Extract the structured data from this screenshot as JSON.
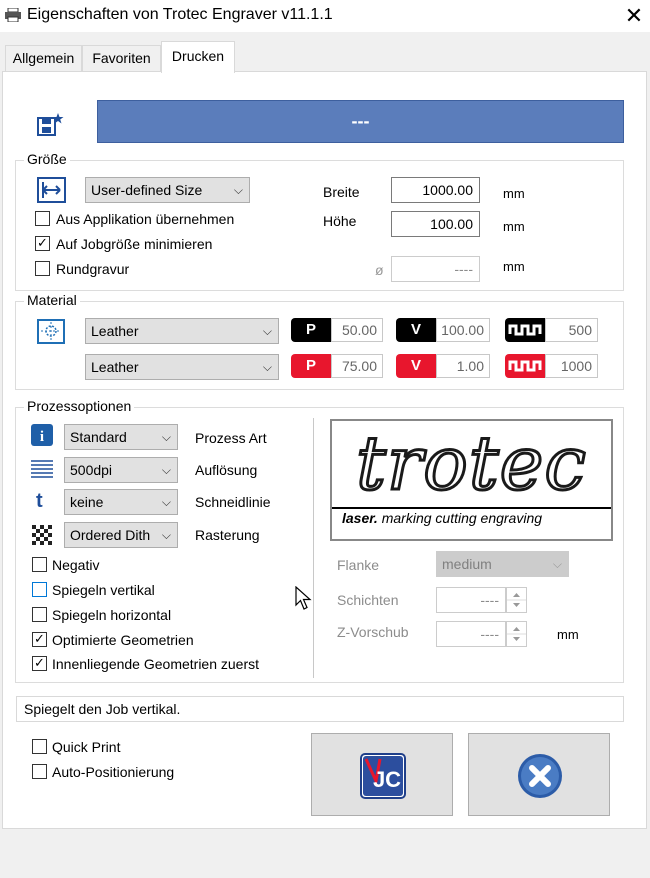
{
  "window": {
    "title": "Eigenschaften von Trotec Engraver v11.1.1",
    "close": "✕"
  },
  "tabs": [
    "Allgemein",
    "Favoriten",
    "Drucken"
  ],
  "favorite_bar": {
    "text": "---"
  },
  "groesse": {
    "legend": "Größe",
    "size_select": "User-defined Size",
    "aus_applikation": "Aus Applikation übernehmen",
    "auf_jobgroesse": "Auf Jobgröße minimieren",
    "rundgravur": "Rundgravur",
    "breite_label": "Breite",
    "breite_value": "1000.00",
    "hoehe_label": "Höhe",
    "hoehe_value": "100.00",
    "diameter_symbol": "ø",
    "diameter_value": "----",
    "unit": "mm"
  },
  "material": {
    "legend": "Material",
    "rows": [
      {
        "select": "Leather",
        "p_label": "P",
        "p_value": "50.00",
        "v_label": "V",
        "v_value": "100.00",
        "freq_value": "500"
      },
      {
        "select": "Leather",
        "p_label": "P",
        "p_value": "75.00",
        "v_label": "V",
        "v_value": "1.00",
        "freq_value": "1000"
      }
    ]
  },
  "prozess": {
    "legend": "Prozessoptionen",
    "rows": [
      {
        "select": "Standard",
        "label": "Prozess Art"
      },
      {
        "select": "500dpi",
        "label": "Auflösung"
      },
      {
        "select": "keine",
        "label": "Schneidlinie"
      },
      {
        "select": "Ordered Dith",
        "label": "Rasterung"
      }
    ],
    "checks": {
      "negativ": "Negativ",
      "spiegeln_vertikal": "Spiegeln vertikal",
      "spiegeln_horizontal": "Spiegeln horizontal",
      "optimierte": "Optimierte Geometrien",
      "innenliegende": "Innenliegende Geometrien zuerst"
    }
  },
  "logo": {
    "word": "trotec",
    "tagline_bold": "laser.",
    "tagline": "marking cutting engraving"
  },
  "right_options": {
    "flanke_label": "Flanke",
    "flanke_value": "medium",
    "schichten_label": "Schichten",
    "schichten_value": "----",
    "zvorschub_label": "Z-Vorschub",
    "zvorschub_value": "----",
    "unit": "mm"
  },
  "status_text": "Spiegelt den Job vertikal.",
  "bottom": {
    "quick_print": "Quick Print",
    "auto_pos": "Auto-Positionierung"
  },
  "colors": {
    "accent_bar": "#5b7dbb",
    "red": "#e8162d",
    "logo_blue": "#1d3d8f"
  }
}
